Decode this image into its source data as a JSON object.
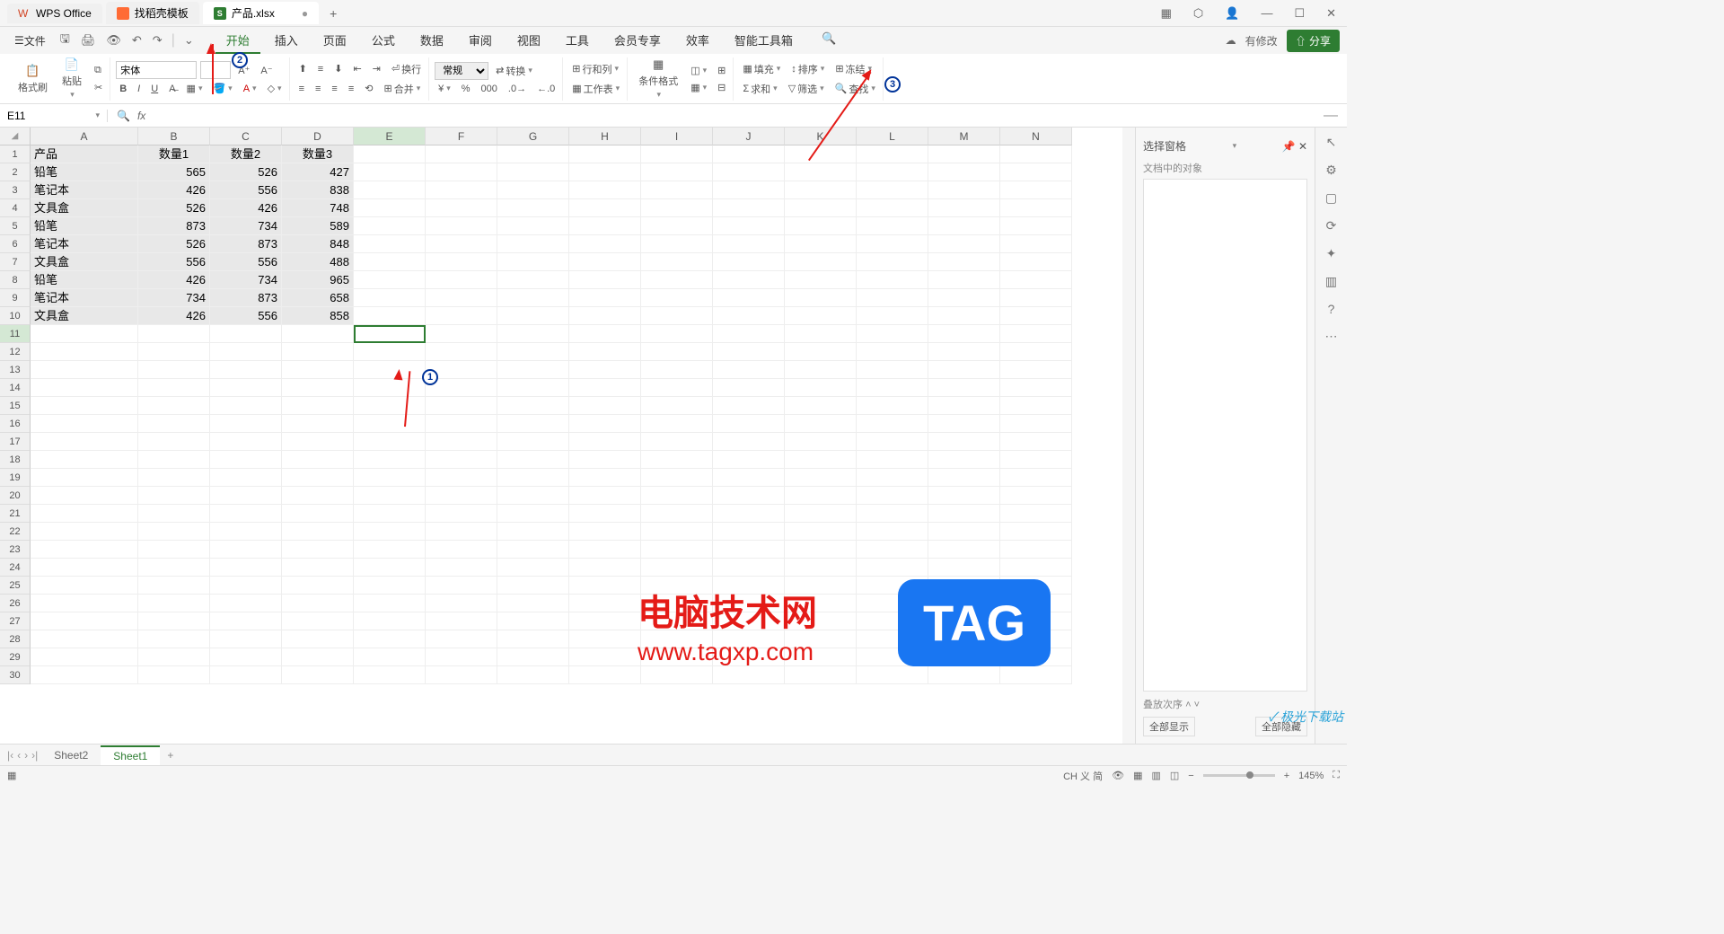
{
  "titlebar": {
    "tabs": [
      {
        "label": "WPS Office",
        "icon": "wps"
      },
      {
        "label": "找稻壳模板",
        "icon": "orange"
      },
      {
        "label": "产品.xlsx",
        "icon": "green",
        "dirty": "●"
      }
    ],
    "add": "+"
  },
  "menubar": {
    "file": "文件",
    "ribbonTabs": [
      "开始",
      "插入",
      "页面",
      "公式",
      "数据",
      "审阅",
      "视图",
      "工具",
      "会员专享",
      "效率",
      "智能工具箱"
    ],
    "hasChanges": "有修改",
    "share": "分享"
  },
  "ribbon": {
    "formatBrush": "格式刷",
    "paste": "粘贴",
    "font": "宋体",
    "general": "常规",
    "convert": "转换",
    "rowCol": "行和列",
    "worksheet": "工作表",
    "condFormat": "条件格式",
    "fill": "填充",
    "sum": "求和",
    "sort": "排序",
    "filter": "筛选",
    "freeze": "冻结",
    "find": "查找",
    "wrap": "换行",
    "merge": "合并"
  },
  "nameBox": "E11",
  "fx": "fx",
  "columns": [
    "A",
    "B",
    "C",
    "D",
    "E",
    "F",
    "G",
    "H",
    "I",
    "J",
    "K",
    "L",
    "M",
    "N"
  ],
  "rowCount": 30,
  "table": {
    "headers": [
      "产品",
      "数量1",
      "数量2",
      "数量3"
    ],
    "rows": [
      [
        "铅笔",
        "565",
        "526",
        "427"
      ],
      [
        "笔记本",
        "426",
        "556",
        "838"
      ],
      [
        "文具盒",
        "526",
        "426",
        "748"
      ],
      [
        "铅笔",
        "873",
        "734",
        "589"
      ],
      [
        "笔记本",
        "526",
        "873",
        "848"
      ],
      [
        "文具盒",
        "556",
        "556",
        "488"
      ],
      [
        "铅笔",
        "426",
        "734",
        "965"
      ],
      [
        "笔记本",
        "734",
        "873",
        "658"
      ],
      [
        "文具盒",
        "426",
        "556",
        "858"
      ]
    ]
  },
  "rightPanel": {
    "title": "选择窗格",
    "subtitle": "文档中的对象",
    "stacking": "叠放次序",
    "showAll": "全部显示",
    "hideAll": "全部隐藏"
  },
  "sheetTabs": {
    "tabs": [
      "Sheet2",
      "Sheet1"
    ],
    "active": 1
  },
  "status": {
    "zoom": "145%",
    "ime": "CH 义 简"
  },
  "annotations": {
    "n1": "1",
    "n2": "2",
    "n3": "3"
  },
  "watermark": {
    "title": "电脑技术网",
    "url": "www.tagxp.com",
    "tag": "TAG",
    "site": "极光下载站"
  }
}
